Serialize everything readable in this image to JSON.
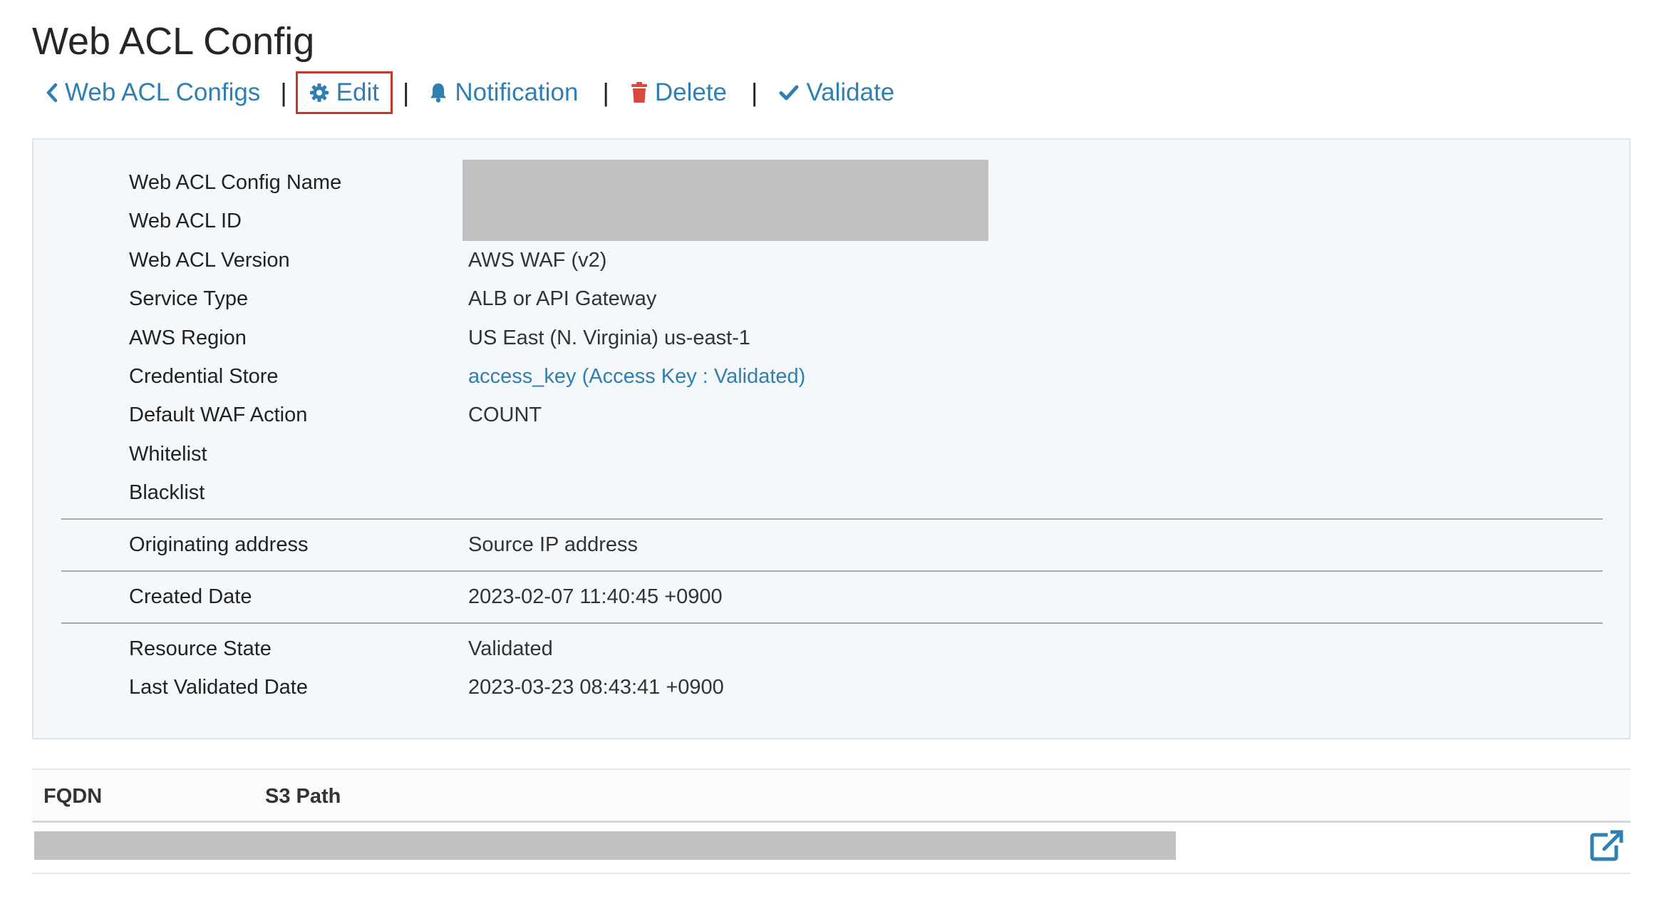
{
  "page": {
    "title": "Web ACL Config"
  },
  "toolbar": {
    "back_label": "Web ACL Configs",
    "edit_label": "Edit",
    "notification_label": "Notification",
    "delete_label": "Delete",
    "validate_label": "Validate",
    "separator": "|",
    "icons": {
      "back": "chevron-left-icon",
      "edit": "gear-icon",
      "notification": "bell-icon",
      "delete": "trash-icon",
      "validate": "check-icon"
    },
    "colors": {
      "link": "#2f7fb0",
      "edit_highlight": "#c0392b",
      "delete_icon": "#d9483b"
    }
  },
  "details": {
    "rows": [
      {
        "label": "Web ACL Config Name",
        "value": ""
      },
      {
        "label": "Web ACL ID",
        "value": ""
      },
      {
        "label": "Web ACL Version",
        "value": "AWS WAF (v2)"
      },
      {
        "label": "Service Type",
        "value": "ALB or API Gateway"
      },
      {
        "label": "AWS Region",
        "value": "US East (N. Virginia) us-east-1"
      },
      {
        "label": "Credential Store",
        "value": "access_key (Access Key : Validated)"
      },
      {
        "label": "Default WAF Action",
        "value": "COUNT"
      },
      {
        "label": "Whitelist",
        "value": ""
      },
      {
        "label": "Blacklist",
        "value": ""
      },
      {
        "label": "Originating address",
        "value": "Source IP address"
      },
      {
        "label": "Created Date",
        "value": "2023-02-07 11:40:45 +0900"
      },
      {
        "label": "Resource State",
        "value": "Validated"
      },
      {
        "label": "Last Validated Date",
        "value": "2023-03-23 08:43:41 +0900"
      }
    ]
  },
  "table": {
    "columns": [
      "FQDN",
      "S3 Path"
    ],
    "rows": [
      {
        "fqdn": "",
        "s3_path": "",
        "action_icon": "external-link-icon"
      }
    ]
  }
}
